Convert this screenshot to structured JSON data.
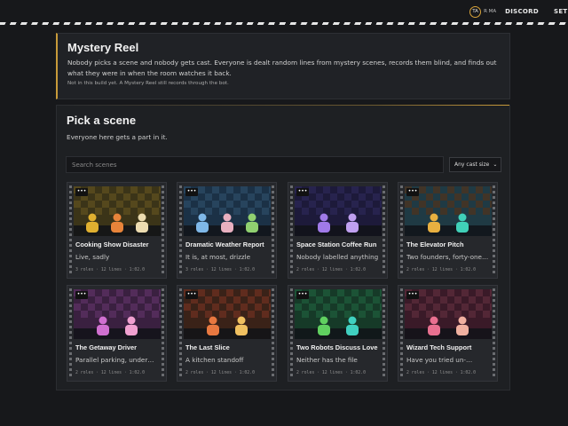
{
  "nav": {
    "avatar_initials": "TA",
    "avatar_name": "R MA",
    "discord": "DISCORD",
    "settings": "SET"
  },
  "intro": {
    "title": "Mystery Reel",
    "lead": "Nobody picks a scene and nobody gets cast. Everyone is dealt random lines from mystery scenes, records them blind, and finds out what they were in when the room watches it back.",
    "note": "Not in this build yet. A Mystery Reel still records through the bot."
  },
  "picker": {
    "title": "Pick a scene",
    "subtitle": "Everyone here gets a part in it.",
    "search_placeholder": "Search scenes",
    "cast_filter": "Any cast size",
    "more_label": "•••"
  },
  "scenes": [
    {
      "title": "Cooking Show Disaster",
      "desc": "Live, sadly",
      "meta": "3 roles · 12 lines · 1:02.0",
      "bg": "#3b3418",
      "accent": "#5c4d1f",
      "figures": [
        "#e0b030",
        "#e8843a",
        "#ecdcb0"
      ]
    },
    {
      "title": "Dramatic Weather Report",
      "desc": "It is, at most, drizzle",
      "meta": "3 roles · 12 lines · 1:02.0",
      "bg": "#1b3146",
      "accent": "#2a4a63",
      "figures": [
        "#7fb8e8",
        "#e8b0c0",
        "#90d070"
      ]
    },
    {
      "title": "Space Station Coffee Run",
      "desc": "Nobody labelled anything",
      "meta": "2 roles · 12 lines · 1:02.0",
      "bg": "#1d1a3a",
      "accent": "#2a2654",
      "figures": [
        "#a07ae8",
        "#c0a0f0"
      ]
    },
    {
      "title": "The Elevator Pitch",
      "desc": "Two founders, forty-one…",
      "meta": "2 roles · 12 lines · 1:02.0",
      "bg": "#1f3a44",
      "accent": "#4a3320",
      "figures": [
        "#e8b040",
        "#40d0b8"
      ]
    },
    {
      "title": "The Getaway Driver",
      "desc": "Parallel parking, under…",
      "meta": "2 roles · 12 lines · 1:02.0",
      "bg": "#3a2040",
      "accent": "#5a3060",
      "figures": [
        "#d070d0",
        "#f0a0d0"
      ]
    },
    {
      "title": "The Last Slice",
      "desc": "A kitchen standoff",
      "meta": "2 roles · 12 lines · 1:02.0",
      "bg": "#3a2218",
      "accent": "#6a3020",
      "figures": [
        "#e87840",
        "#f0c060"
      ]
    },
    {
      "title": "Two Robots Discuss Love",
      "desc": "Neither has the file",
      "meta": "2 roles · 12 lines · 1:02.0",
      "bg": "#163a28",
      "accent": "#1e5a3a",
      "figures": [
        "#60d060",
        "#40d0c0"
      ]
    },
    {
      "title": "Wizard Tech Support",
      "desc": "Have you tried un-…",
      "meta": "2 roles · 12 lines · 1:02.0",
      "bg": "#3a1a28",
      "accent": "#5a2a3a",
      "figures": [
        "#e87090",
        "#f0b0a0"
      ]
    }
  ]
}
